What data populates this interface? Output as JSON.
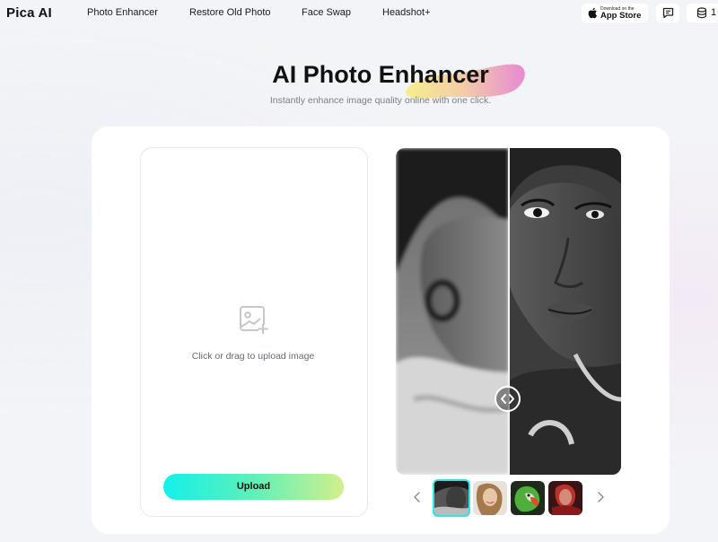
{
  "header": {
    "logo": "Pica AI",
    "nav": [
      "Photo Enhancer",
      "Restore Old Photo",
      "Face Swap",
      "Headshot+"
    ],
    "app_store": {
      "small": "Download on the",
      "big": "App Store"
    },
    "credits": "1"
  },
  "hero": {
    "title": "AI Photo Enhancer",
    "subtitle": "Instantly enhance image quality online with one click."
  },
  "upload": {
    "drop_text": "Click or drag to upload image",
    "button": "Upload"
  },
  "compare": {
    "split_position": 0.5,
    "thumbnails": [
      {
        "name": "woman-bw",
        "selected": true
      },
      {
        "name": "woman-smiling",
        "selected": false
      },
      {
        "name": "parrot",
        "selected": false
      },
      {
        "name": "red-portrait",
        "selected": false
      }
    ]
  },
  "colors": {
    "accent_cyan": "#14f0ea",
    "accent_lime": "#d2ef8c",
    "blob_pink": "#e589cc",
    "blob_yellow": "#f3e57a"
  },
  "icons": [
    "apple-icon",
    "feedback-icon",
    "coins-icon",
    "image-upload-icon",
    "compare-handle-icon",
    "chevron-left-icon",
    "chevron-right-icon"
  ]
}
